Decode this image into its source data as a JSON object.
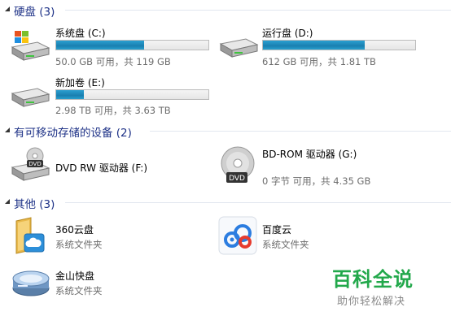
{
  "groups": {
    "hard_disks": {
      "title": "硬盘 (3)"
    },
    "removable": {
      "title": "有可移动存储的设备 (2)"
    },
    "other": {
      "title": "其他 (3)"
    }
  },
  "drives": [
    {
      "name": "系统盘 (C:)",
      "info": "50.0 GB 可用，共 119 GB",
      "used_fraction": 0.58,
      "icon": "windows-drive-icon"
    },
    {
      "name": "运行盘 (D:)",
      "info": "612 GB 可用，共 1.81 TB",
      "used_fraction": 0.67,
      "icon": "hard-drive-icon"
    },
    {
      "name": "新加卷 (E:)",
      "info": "2.98 TB 可用，共 3.63 TB",
      "used_fraction": 0.18,
      "icon": "hard-drive-icon"
    }
  ],
  "removable": [
    {
      "name": "DVD RW 驱动器 (F:)",
      "info": "",
      "icon": "dvd-rw-drive-icon"
    },
    {
      "name": "BD-ROM 驱动器 (G:)",
      "info": "0 字节 可用，共 4.35 GB",
      "icon": "dvd-disc-icon"
    }
  ],
  "other": [
    {
      "name": "360云盘",
      "info": "系统文件夹",
      "icon": "cloud-folder-icon"
    },
    {
      "name": "百度云",
      "info": "系统文件夹",
      "icon": "baidu-cloud-icon"
    },
    {
      "name": "金山快盘",
      "info": "系统文件夹",
      "icon": "kuaipan-drive-icon"
    }
  ],
  "watermark": {
    "title": "百科全说",
    "subtitle": "助你轻松解决"
  },
  "colors": {
    "group_title": "#1e3287",
    "bar_fill": "#1a86b8",
    "info_text": "#6d6d6d"
  }
}
